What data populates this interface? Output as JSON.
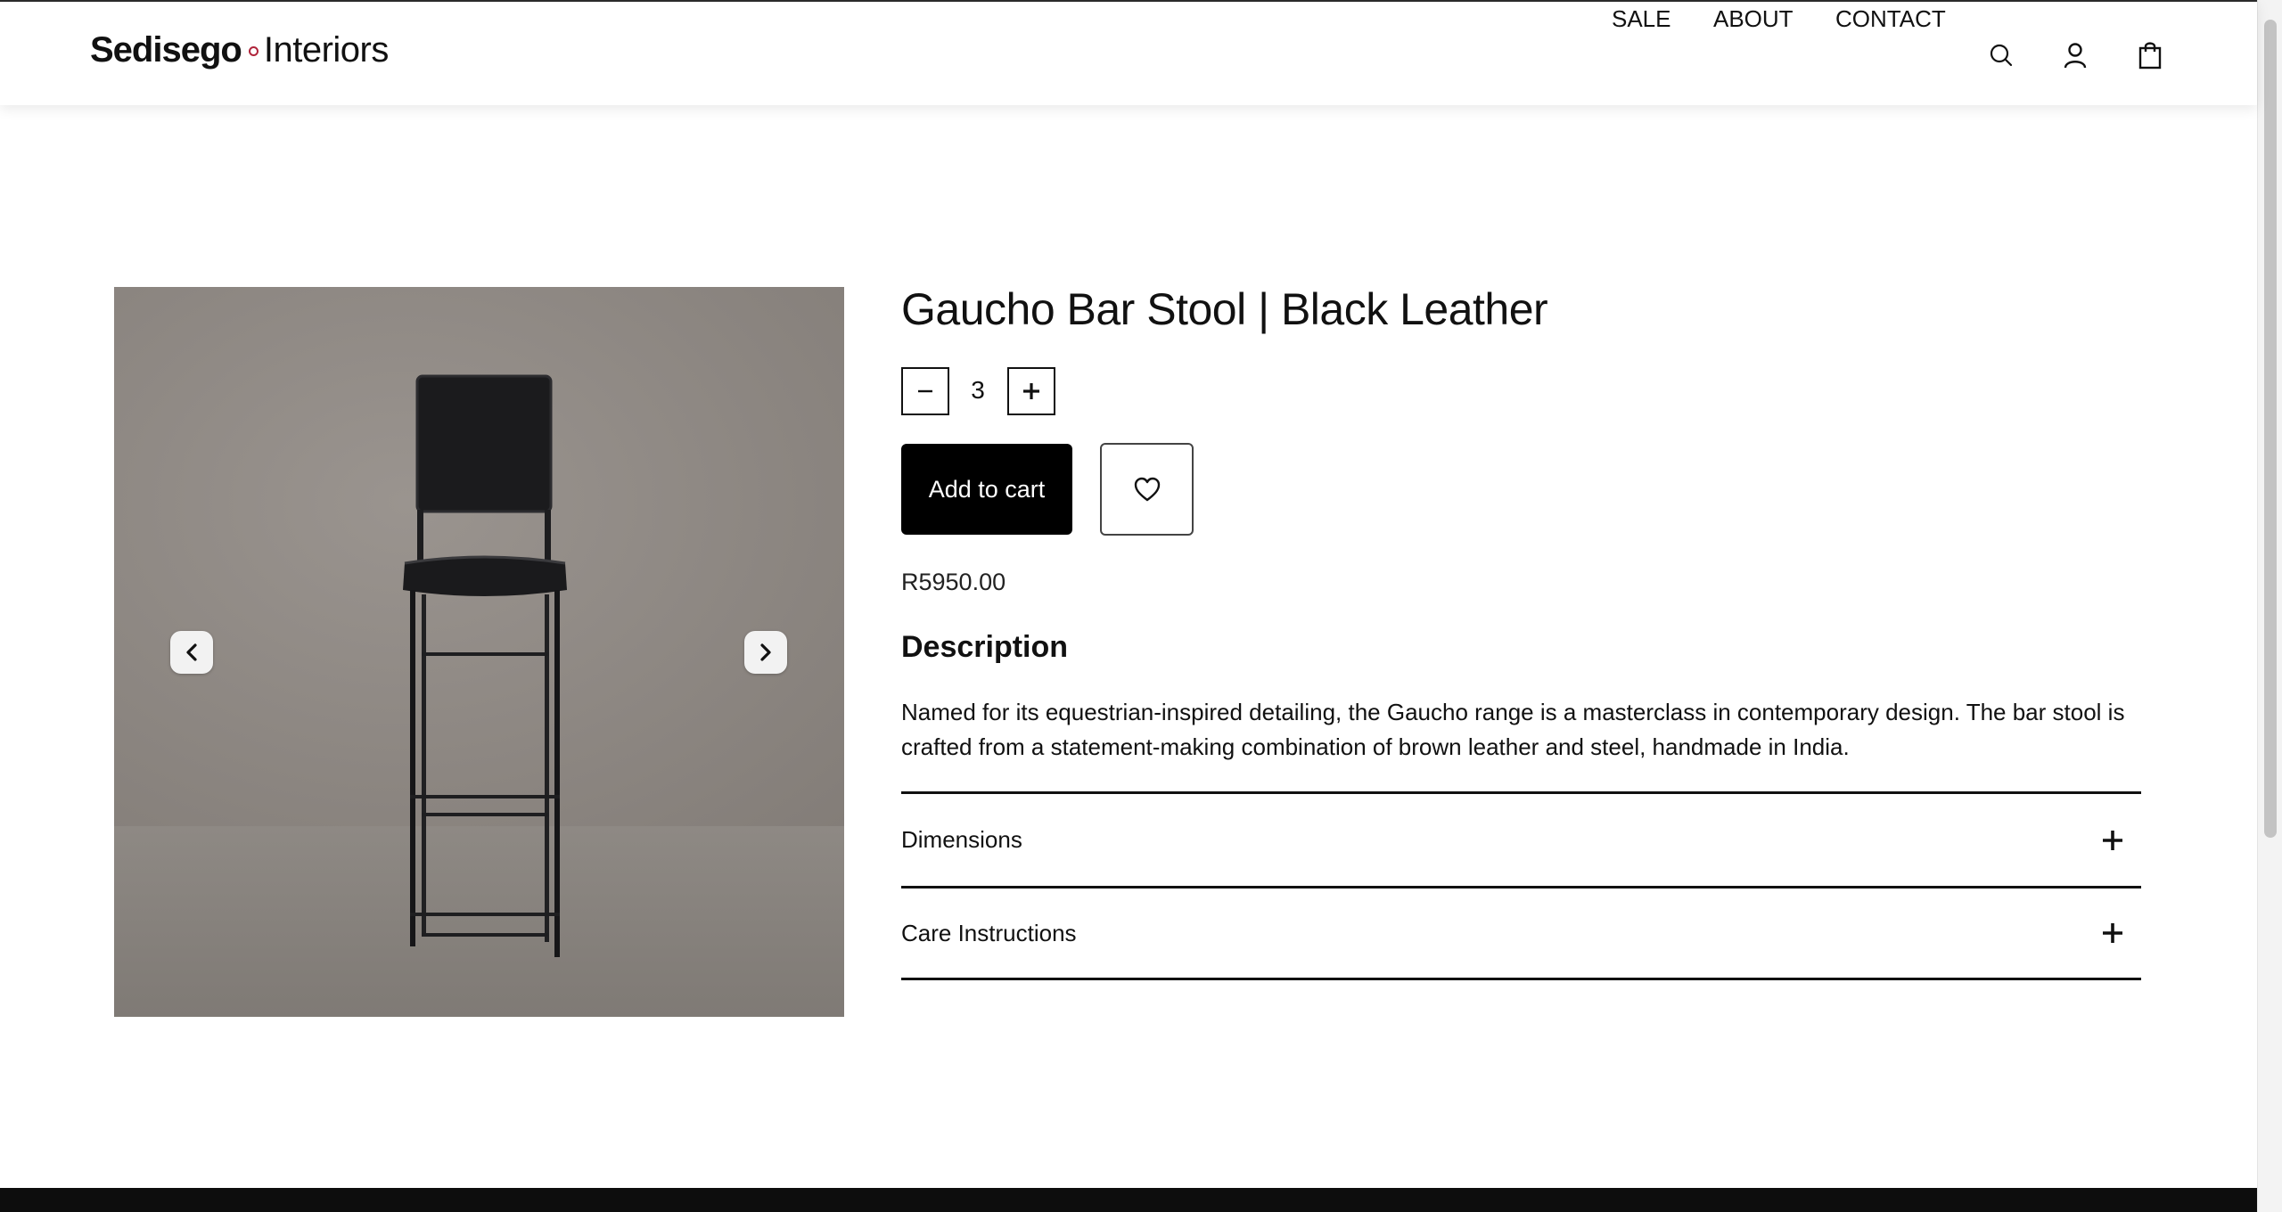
{
  "header": {
    "logo_brand": "Sedisego",
    "logo_sub": "Interiors",
    "nav": [
      "SALE",
      "ABOUT",
      "CONTACT"
    ],
    "icons": [
      "search-icon",
      "account-icon",
      "cart-bag-icon"
    ]
  },
  "product": {
    "title": "Gaucho Bar Stool | Black Leather",
    "quantity": "3",
    "add_to_cart_label": "Add to cart",
    "price": "R5950.00",
    "description_heading": "Description",
    "description": "Named for its equestrian-inspired detailing, the Gaucho range is a masterclass in contemporary design. The bar stool is crafted from a statement-making combination of brown leather and steel, handmade in India.",
    "accordions": [
      "Dimensions",
      "Care Instructions"
    ]
  },
  "colors": {
    "primary": "#000000",
    "background": "#ffffff",
    "brand_dot": "#b0243a"
  }
}
